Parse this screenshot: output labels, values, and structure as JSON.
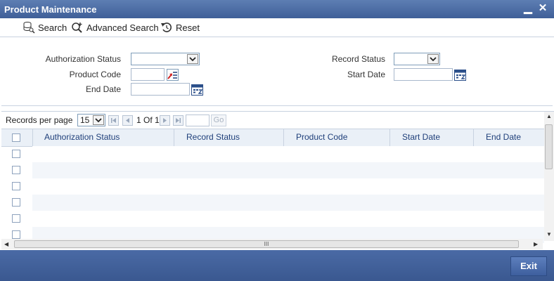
{
  "window": {
    "title": "Product Maintenance",
    "minimize": "▁",
    "close": "✕"
  },
  "toolbar": {
    "search": "Search",
    "advanced_search": "Advanced Search",
    "reset": "Reset"
  },
  "form": {
    "authorization_status_label": "Authorization Status",
    "product_code_label": "Product Code",
    "end_date_label": "End Date",
    "record_status_label": "Record Status",
    "start_date_label": "Start Date",
    "authorization_status_value": "",
    "product_code_value": "",
    "end_date_value": "",
    "record_status_value": "",
    "start_date_value": ""
  },
  "pager": {
    "records_per_page_label": "Records per page",
    "records_per_page_value": "15",
    "page_info": "1 Of 1",
    "go_label": "Go"
  },
  "table": {
    "columns": [
      "Authorization Status",
      "Record Status",
      "Product Code",
      "Start Date",
      "End Date"
    ],
    "rows": 6
  },
  "hscroll_grip": "III",
  "footer": {
    "exit": "Exit"
  },
  "colors": {
    "title_bar": "#4b6ca6",
    "header_text": "#1f3f7a",
    "footer": "#3f5e96"
  }
}
